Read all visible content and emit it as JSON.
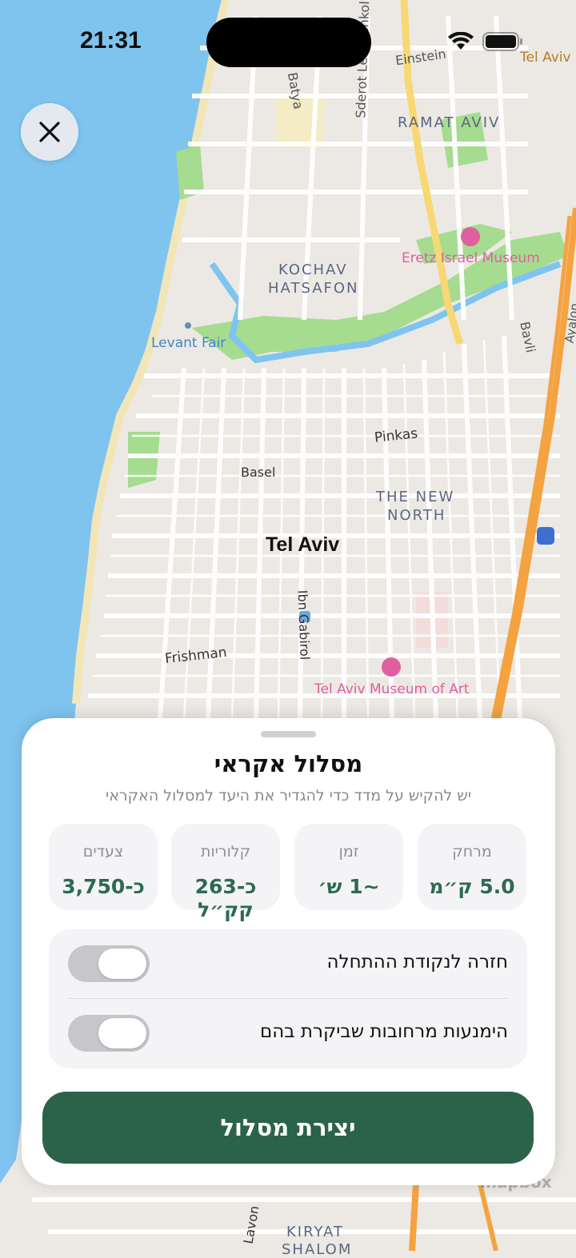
{
  "status": {
    "time": "21:31"
  },
  "map": {
    "labels": {
      "tel_aviv": "Tel Aviv",
      "tel_aviv_corner": "Tel Aviv",
      "einstein": "Einstein",
      "batya": "Batya",
      "sderot": "Sderot Levi Eshkol",
      "ramat_aviv": "RAMAT AVIV",
      "eretz_israel_museum": "Eretz Israel Museum",
      "kochav": "KOCHAV",
      "hatsafon": "HATSAFON",
      "levant_fair": "Levant Fair",
      "bavli": "Bavli",
      "ayalon": "Ayalon",
      "pinkas": "Pinkas",
      "basel": "Basel",
      "the_new": "THE NEW",
      "north": "NORTH",
      "ibn_gabirol": "Ibn Gabirol",
      "frishman": "Frishman",
      "museum_of_art": "Tel Aviv Museum of Art",
      "kiryat": "KIRYAT",
      "shalom": "SHALOM",
      "lavon": "Lavon",
      "mapbox": "mapbox"
    },
    "colors": {
      "water": "#7fc4ef",
      "park": "#9fd88a",
      "land": "#ece9e4",
      "road": "#ffffff",
      "highway": "#f4a340",
      "main_road": "#f7d873",
      "poi": "#e05fa0",
      "label": "#5b6680"
    }
  },
  "sheet": {
    "title": "מסלול אקראי",
    "subtitle": "יש להקיש על מדד כדי להגדיר את היעד למסלול האקראי",
    "stats": [
      {
        "label": "מרחק",
        "value": "5.0 ק״מ"
      },
      {
        "label": "זמן",
        "value": "~1 ש׳"
      },
      {
        "label": "קלוריות",
        "value": "כ-263 קק״ל"
      },
      {
        "label": "צעדים",
        "value": "כ-3,750"
      }
    ],
    "toggles": [
      {
        "label": "חזרה לנקודת ההתחלה",
        "on": false
      },
      {
        "label": "הימנעות מרחובות שביקרת בהם",
        "on": false
      }
    ],
    "create_label": "יצירת מסלול"
  }
}
